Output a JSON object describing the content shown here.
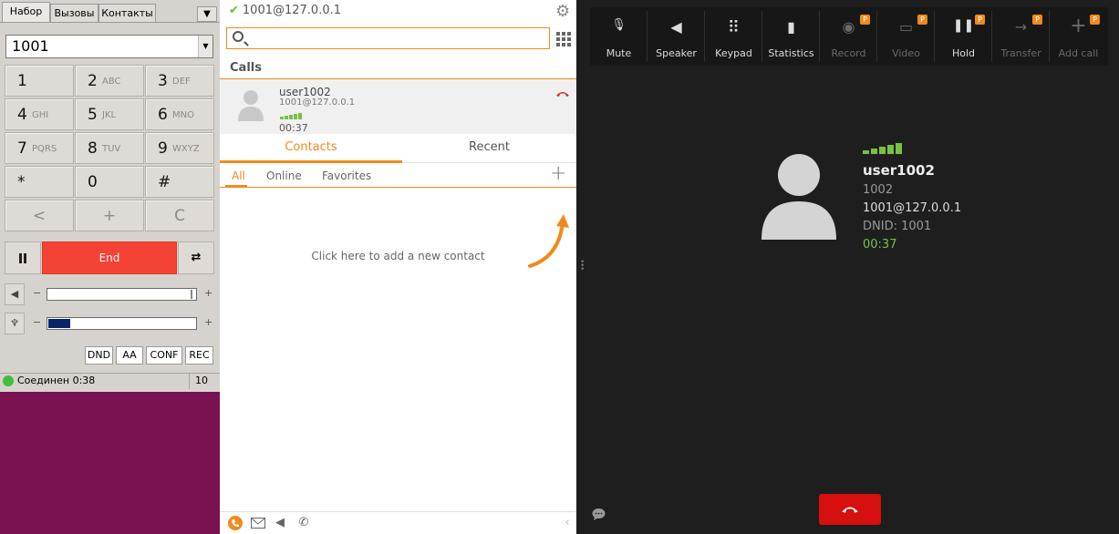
{
  "softphone": {
    "tabs": [
      "Набор",
      "Вызовы",
      "Контакты"
    ],
    "number": "1001",
    "keys": [
      {
        "d": "1",
        "l": ""
      },
      {
        "d": "2",
        "l": "ABC"
      },
      {
        "d": "3",
        "l": "DEF"
      },
      {
        "d": "4",
        "l": "GHI"
      },
      {
        "d": "5",
        "l": "JKL"
      },
      {
        "d": "6",
        "l": "MNO"
      },
      {
        "d": "7",
        "l": "PQRS"
      },
      {
        "d": "8",
        "l": "TUV"
      },
      {
        "d": "9",
        "l": "WXYZ"
      },
      {
        "d": "*",
        "l": ""
      },
      {
        "d": "0",
        "l": ""
      },
      {
        "d": "#",
        "l": ""
      },
      {
        "d": "<",
        "l": ""
      },
      {
        "d": "+",
        "l": ""
      },
      {
        "d": "C",
        "l": ""
      }
    ],
    "end_label": "End",
    "speaker_volume": 0.98,
    "mic_level": 0.15,
    "minus": "−",
    "plus": "+",
    "buttons": [
      "DND",
      "AA",
      "CONF",
      "REC"
    ],
    "status_text": "Соединен 0:38",
    "status_count": "10"
  },
  "zoiper": {
    "account": "1001@127.0.0.1",
    "calls_header": "Calls",
    "call": {
      "name": "user1002",
      "uri": "1001@127.0.0.1",
      "time": "00:37"
    },
    "tabs": [
      "Contacts",
      "Recent"
    ],
    "filters": [
      "All",
      "Online",
      "Favorites"
    ],
    "hint": "Click here to add a new contact"
  },
  "callscreen": {
    "toolbar": [
      {
        "label": "Mute",
        "icon": "mic-muted-icon",
        "disabled": false,
        "badge": ""
      },
      {
        "label": "Speaker",
        "icon": "speaker-icon",
        "disabled": false,
        "badge": ""
      },
      {
        "label": "Keypad",
        "icon": "keypad-icon",
        "disabled": false,
        "badge": ""
      },
      {
        "label": "Statistics",
        "icon": "statistics-icon",
        "disabled": false,
        "badge": ""
      },
      {
        "label": "Record",
        "icon": "record-icon",
        "disabled": true,
        "badge": "P"
      },
      {
        "label": "Video",
        "icon": "video-icon",
        "disabled": true,
        "badge": "P"
      },
      {
        "label": "Hold",
        "icon": "hold-icon",
        "disabled": false,
        "badge": "P"
      },
      {
        "label": "Transfer",
        "icon": "transfer-icon",
        "disabled": true,
        "badge": "P"
      },
      {
        "label": "Add call",
        "icon": "add-call-icon",
        "disabled": true,
        "badge": "P"
      }
    ],
    "contact": {
      "name": "user1002",
      "number": "1002",
      "uri": "1001@127.0.0.1",
      "dnid": "DNID: 1001",
      "time": "00:37"
    }
  },
  "colors": {
    "accent": "#f08a1c",
    "end_red": "#f44336",
    "hangup_red": "#d60f0f",
    "signal_green": "#7ac142"
  }
}
